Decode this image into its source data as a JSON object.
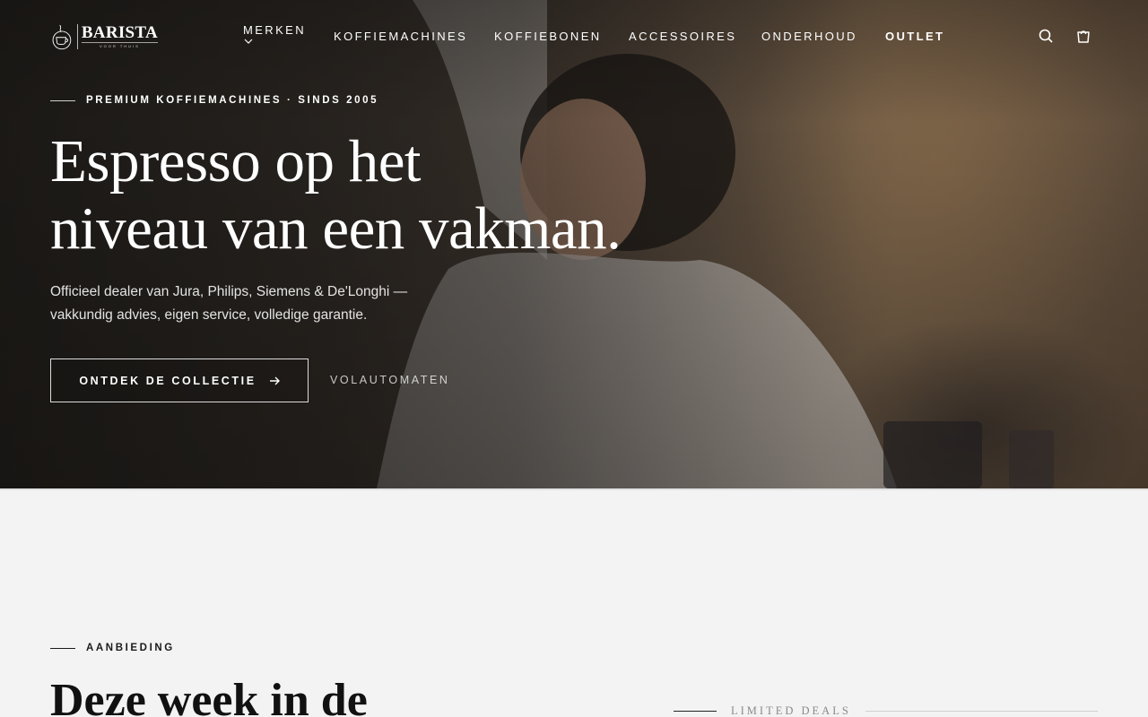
{
  "brand": {
    "name": "BARISTA",
    "tagline": "VOOR THUIS"
  },
  "nav": {
    "items": [
      {
        "label": "MERKEN",
        "has_dropdown": true
      },
      {
        "label": "KOFFIEMACHINES"
      },
      {
        "label": "KOFFIEBONEN"
      },
      {
        "label": "ACCESSOIRES"
      },
      {
        "label": "ONDERHOUD"
      },
      {
        "label": "OUTLET",
        "emphasis": true
      }
    ],
    "icons": [
      "search-icon",
      "cart-icon"
    ]
  },
  "hero": {
    "eyebrow": "PREMIUM KOFFIEMACHINES · SINDS 2005",
    "title_line1": "Espresso op het",
    "title_line2": "niveau van een vakman.",
    "subtitle_line1": "Officieel dealer van Jura, Philips, Siemens & De'Longhi —",
    "subtitle_line2": "vakkundig advies, eigen service, volledige garantie.",
    "cta_primary": "ONTDEK DE COLLECTIE",
    "cta_primary_icon": "arrow-right-icon",
    "cta_secondary": "VOLAUTOMATEN"
  },
  "deals": {
    "eyebrow": "AANBIEDING",
    "title": "Deze week in de",
    "side_label": "LIMITED DEALS"
  },
  "colors": {
    "hero_text": "#ffffff",
    "page_bg": "#f3f3f3",
    "dark_text": "#111111",
    "muted_text": "#8a8a8a"
  }
}
